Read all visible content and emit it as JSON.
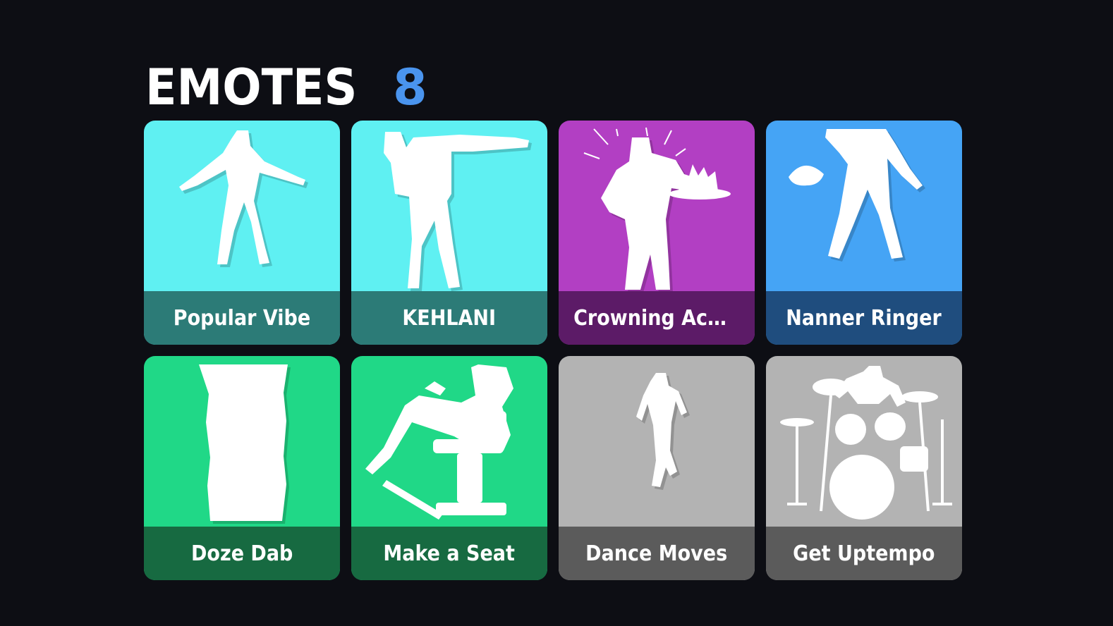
{
  "header": {
    "title": "EMOTES",
    "count": "8",
    "count_color": "#4a94ee"
  },
  "emotes": [
    {
      "label": "Popular Vibe",
      "color": "#5ff0f2",
      "band": "#2c7b77",
      "icon": "dancer-arms-out-icon"
    },
    {
      "label": "KEHLANI",
      "color": "#5ff0f2",
      "band": "#2c7b77",
      "icon": "dancer-pointing-icon"
    },
    {
      "label": "Crowning Ach...",
      "color": "#b23fc3",
      "band": "#5c1b67",
      "icon": "figure-with-cake-icon"
    },
    {
      "label": "Nanner Ringer",
      "color": "#45a4f5",
      "band": "#1f4d7e",
      "icon": "figure-with-banana-icon"
    },
    {
      "label": "Doze Dab",
      "color": "#20d887",
      "band": "#176a41",
      "icon": "sleeping-dab-icon"
    },
    {
      "label": "Make a Seat",
      "color": "#20d887",
      "band": "#176a41",
      "icon": "figure-in-chair-icon"
    },
    {
      "label": "Dance Moves",
      "color": "#b3b3b3",
      "band": "#5b5b5b",
      "icon": "dancer-running-icon"
    },
    {
      "label": "Get Uptempo",
      "color": "#b3b3b3",
      "band": "#5b5b5b",
      "icon": "drummer-kit-icon"
    }
  ]
}
